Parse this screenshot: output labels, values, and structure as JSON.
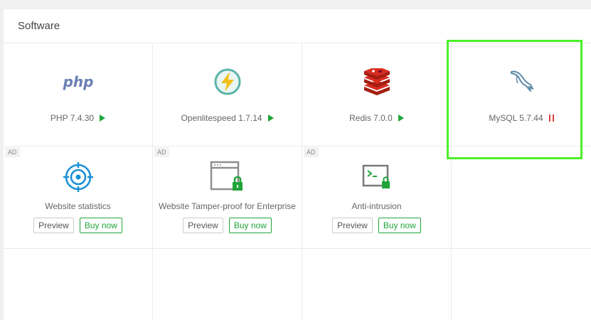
{
  "panel": {
    "title": "Software"
  },
  "software": [
    {
      "name": "PHP 7.4.30",
      "icon": "php-icon",
      "status": "stopped"
    },
    {
      "name": "Openlitespeed 1.7.14",
      "icon": "openlitespeed-icon",
      "status": "stopped"
    },
    {
      "name": "Redis 7.0.0",
      "icon": "redis-icon",
      "status": "stopped"
    },
    {
      "name": "MySQL 5.7.44",
      "icon": "mysql-icon",
      "status": "running"
    }
  ],
  "ads": [
    {
      "tag": "AD",
      "name": "Website statistics",
      "icon": "target-icon",
      "preview": "Preview",
      "buy": "Buy now"
    },
    {
      "tag": "AD",
      "name": "Website Tamper-proof for Enterprise",
      "icon": "window-lock-icon",
      "preview": "Preview",
      "buy": "Buy now"
    },
    {
      "tag": "AD",
      "name": "Anti-intrusion",
      "icon": "terminal-lock-icon",
      "preview": "Preview",
      "buy": "Buy now"
    }
  ],
  "colors": {
    "accent": "#20a53a",
    "pause": "#e04040",
    "highlight": "#4cf02a",
    "php_text": "#6b7fb3"
  },
  "php_logo_text": "php"
}
